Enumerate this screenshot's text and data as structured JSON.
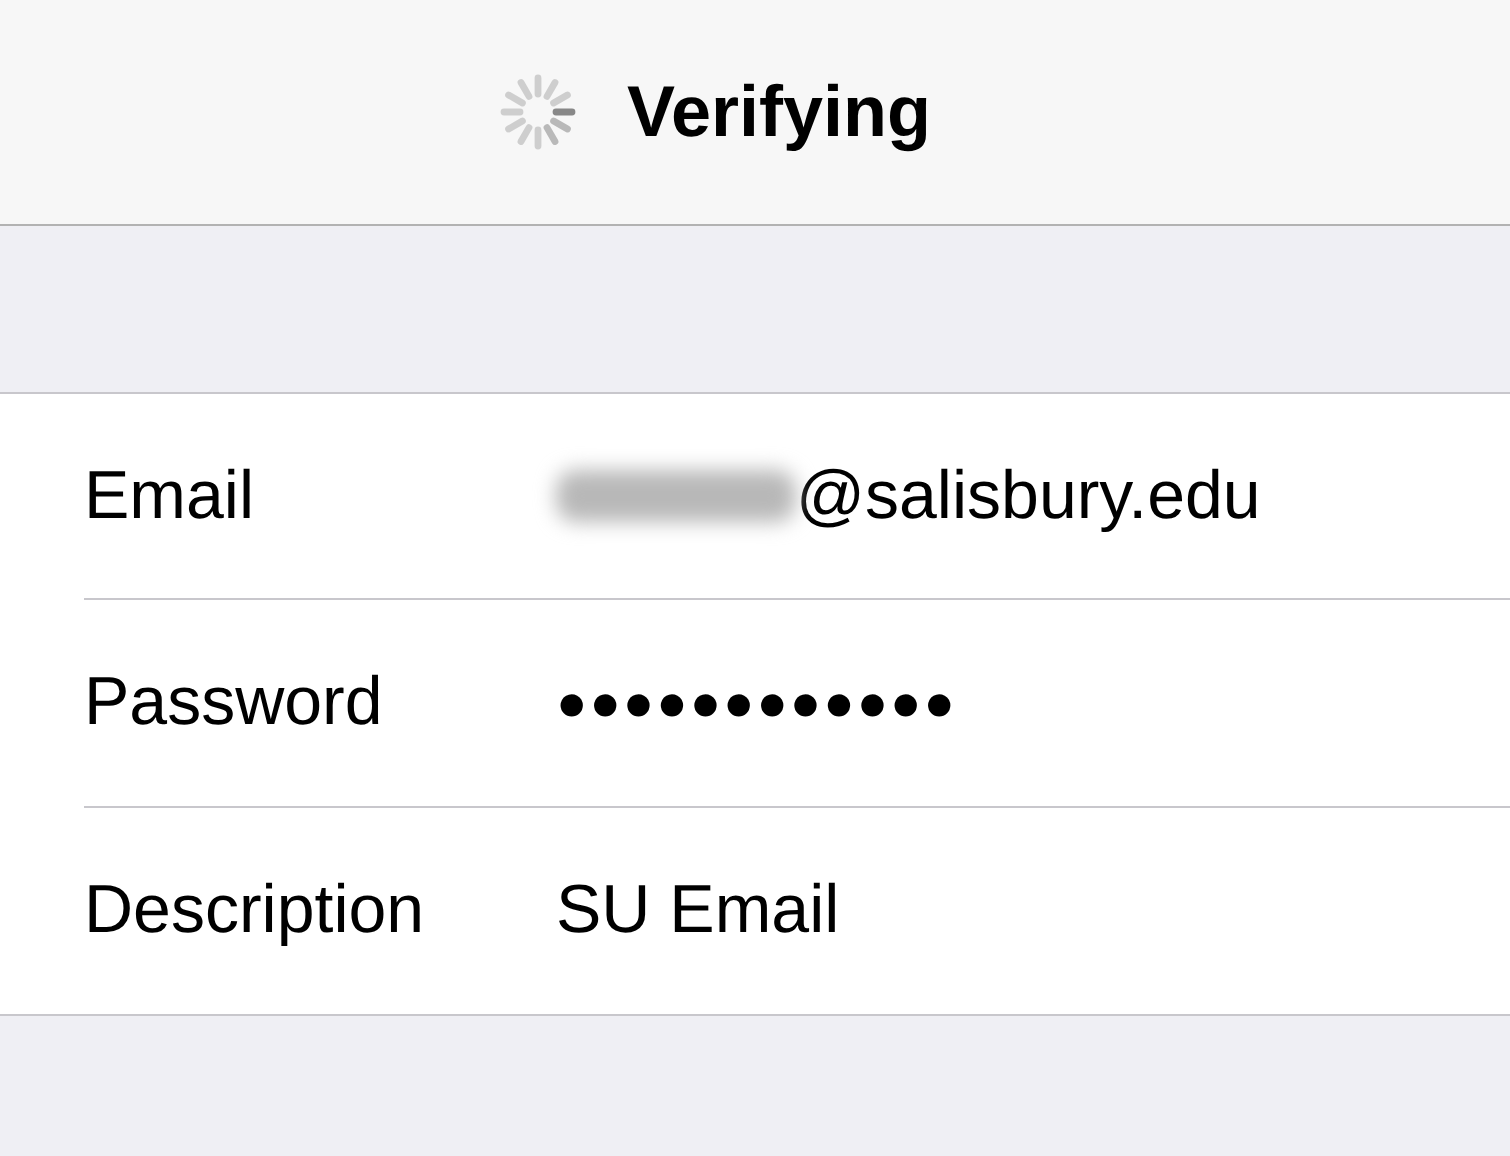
{
  "nav_bar": {
    "title": "Verifying",
    "loading": true
  },
  "fields": [
    {
      "label": "Email",
      "value": "@salisbury.edu",
      "kind": "text",
      "redacted": true
    },
    {
      "label": "Password",
      "value": "●●●●●●●●●●●●",
      "kind": "secure",
      "redacted": false
    },
    {
      "label": "Description",
      "value": "SU Email",
      "kind": "text",
      "redacted": false
    }
  ]
}
